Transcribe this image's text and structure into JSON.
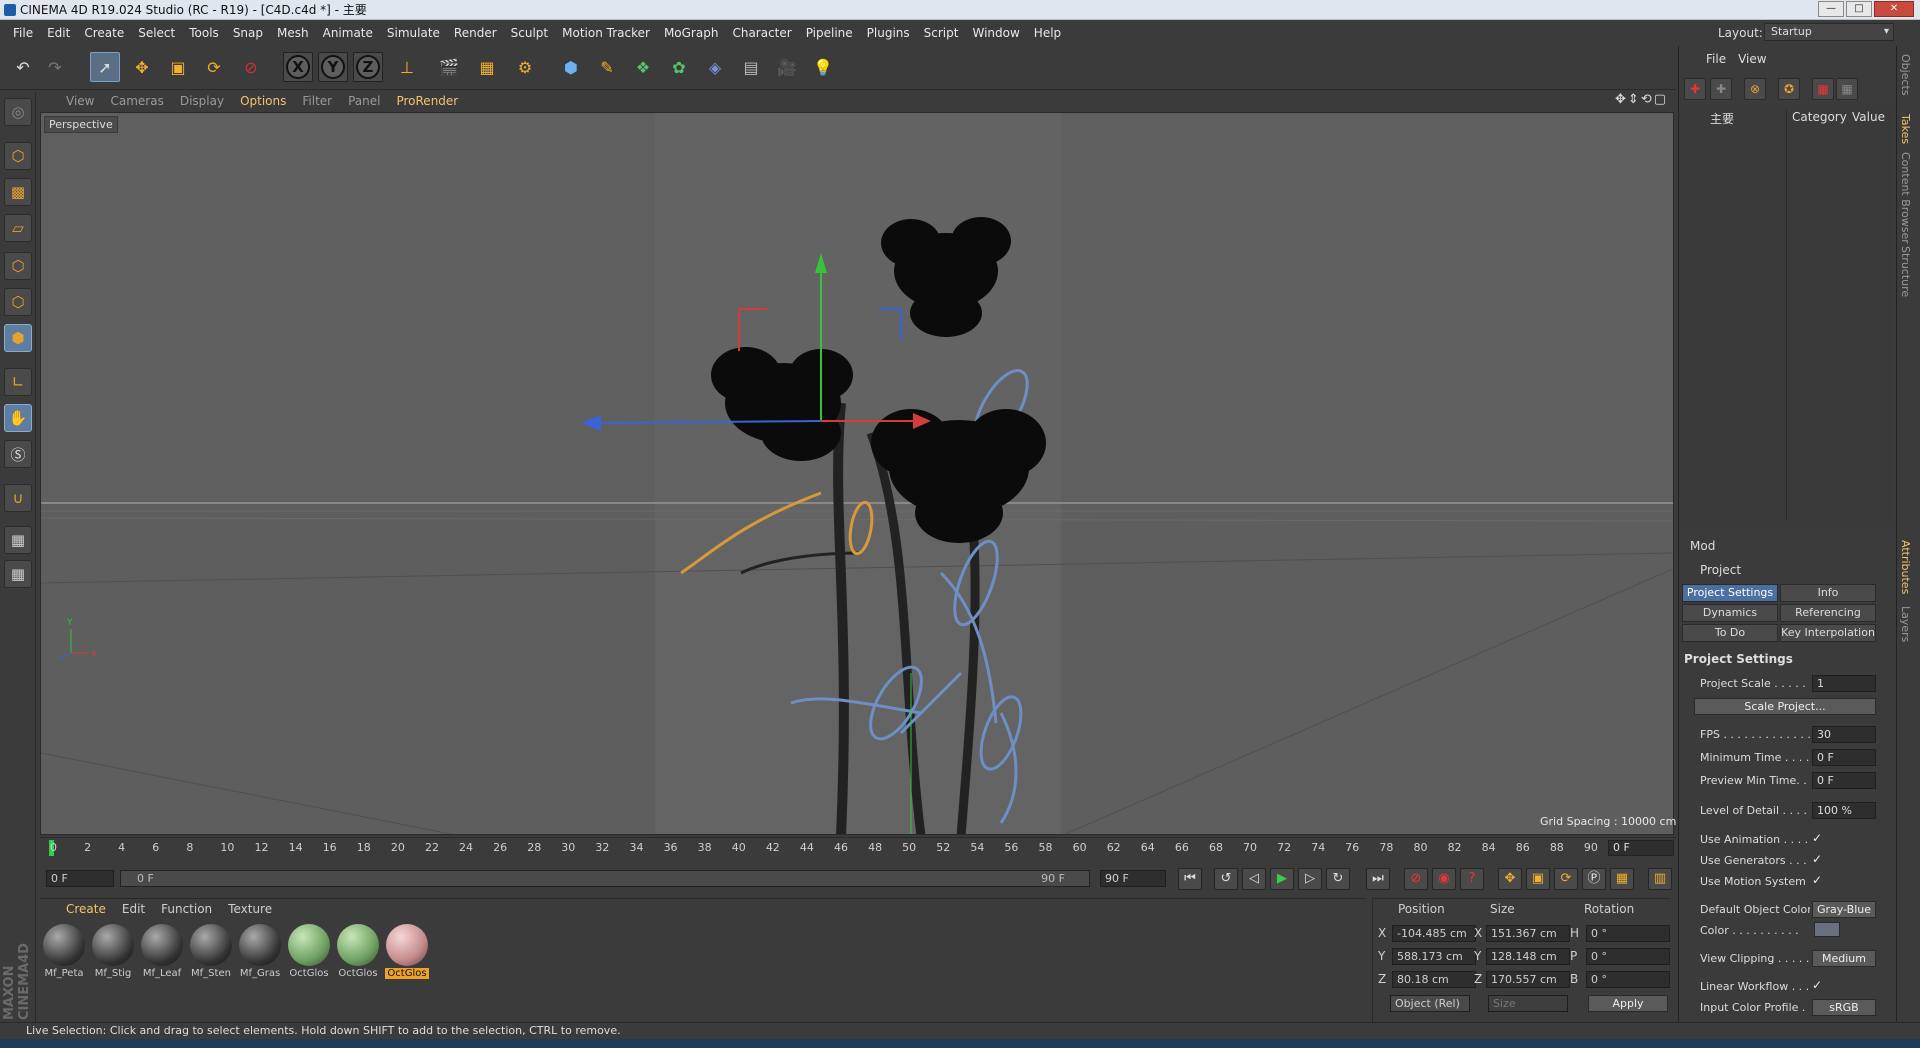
{
  "title": "CINEMA 4D R19.024 Studio (RC - R19) - [C4D.c4d *] - 主要",
  "menu": [
    "File",
    "Edit",
    "Create",
    "Select",
    "Tools",
    "Snap",
    "Mesh",
    "Animate",
    "Simulate",
    "Render",
    "Sculpt",
    "Motion Tracker",
    "MoGraph",
    "Character",
    "Pipeline",
    "Plugins",
    "Script",
    "Window",
    "Help"
  ],
  "layout": {
    "label": "Layout:",
    "value": "Startup"
  },
  "viewport": {
    "menu": [
      "View",
      "Cameras",
      "Display",
      "Options",
      "Filter",
      "Panel",
      "ProRender"
    ],
    "active_menu": "Options",
    "label": "Perspective",
    "grid_spacing": "Grid Spacing : 10000 cm"
  },
  "timeline": {
    "ticks": [
      "0",
      "2",
      "4",
      "6",
      "8",
      "10",
      "12",
      "14",
      "16",
      "18",
      "20",
      "22",
      "24",
      "26",
      "28",
      "30",
      "32",
      "34",
      "36",
      "38",
      "40",
      "42",
      "44",
      "46",
      "48",
      "50",
      "52",
      "54",
      "56",
      "58",
      "60",
      "62",
      "64",
      "66",
      "68",
      "70",
      "72",
      "74",
      "76",
      "78",
      "80",
      "82",
      "84",
      "86",
      "88",
      "90"
    ],
    "current_frame": "0 F",
    "start": "0 F",
    "slider_start": "0 F",
    "slider_end": "90 F",
    "end": "90 F"
  },
  "materials": {
    "menu": [
      "Create",
      "Edit",
      "Function",
      "Texture"
    ],
    "items": [
      {
        "name": "Mf_Peta",
        "kind": "dark"
      },
      {
        "name": "Mf_Stig",
        "kind": "dark"
      },
      {
        "name": "Mf_Leaf",
        "kind": "dark"
      },
      {
        "name": "Mf_Sten",
        "kind": "dark"
      },
      {
        "name": "Mf_Gras",
        "kind": "dark"
      },
      {
        "name": "OctGlos",
        "kind": "green"
      },
      {
        "name": "OctGlos",
        "kind": "green"
      },
      {
        "name": "OctGlos",
        "kind": "pink"
      }
    ],
    "selected_index": 7
  },
  "coords": {
    "headers": {
      "position": "Position",
      "size": "Size",
      "rotation": "Rotation"
    },
    "rows": [
      {
        "pl": "X",
        "pv": "-104.485 cm",
        "sl": "X",
        "sv": "151.367 cm",
        "rl": "H",
        "rv": "0 °"
      },
      {
        "pl": "Y",
        "pv": "588.173 cm",
        "sl": "Y",
        "sv": "128.148 cm",
        "rl": "P",
        "rv": "0 °"
      },
      {
        "pl": "Z",
        "pv": "80.18 cm",
        "sl": "Z",
        "sv": "170.557 cm",
        "rl": "B",
        "rv": "0 °"
      }
    ],
    "mode": "Object (Rel)",
    "size_mode": "Size",
    "apply": "Apply"
  },
  "status": "Live Selection: Click and drag to select elements. Hold down SHIFT to add to the selection, CTRL to remove.",
  "objects": {
    "menu": [
      "File",
      "View"
    ],
    "col_name": "主要",
    "col_category": "Category",
    "col_value": "Value"
  },
  "right_tabs": [
    "Objects",
    "Takes",
    "Content Browser",
    "Structure"
  ],
  "attr_tabs_side": [
    "Attributes",
    "Layers"
  ],
  "attributes": {
    "menu": "Mod",
    "title": "Project",
    "tabs": [
      "Project Settings",
      "Info",
      "Dynamics",
      "Referencing",
      "To Do",
      "Key Interpolation"
    ],
    "section": "Project Settings",
    "props": [
      {
        "label": "Project Scale . . . . . .",
        "value": "1"
      },
      {
        "label": "FPS . . . . . . . . . . . . . . .",
        "value": "30"
      },
      {
        "label": "Minimum Time . . . . .",
        "value": "0 F"
      },
      {
        "label": "Preview Min Time. . .",
        "value": "0 F"
      },
      {
        "label": "Level of Detail . . . . .",
        "value": "100 %"
      },
      {
        "label": "Use Animation . . . . .",
        "value": "✓"
      },
      {
        "label": "Use Generators . . . .",
        "value": "✓"
      },
      {
        "label": "Use Motion System",
        "value": "✓"
      },
      {
        "label": "Default Object Color",
        "value": "Gray-Blue"
      },
      {
        "label": "Color . . . . . . . . . .",
        "value": ""
      },
      {
        "label": "View Clipping . . . . .",
        "value": "Medium"
      },
      {
        "label": "Linear Workflow . . .",
        "value": "✓"
      },
      {
        "label": "Input Color Profile . .",
        "value": "sRGB"
      }
    ],
    "scale_btn": "Scale Project..."
  },
  "colors": {
    "accent": "#f3c36e",
    "selection": "#4b6fa0",
    "bg": "#3b3b3b",
    "viewport": "#5c5c5c"
  }
}
